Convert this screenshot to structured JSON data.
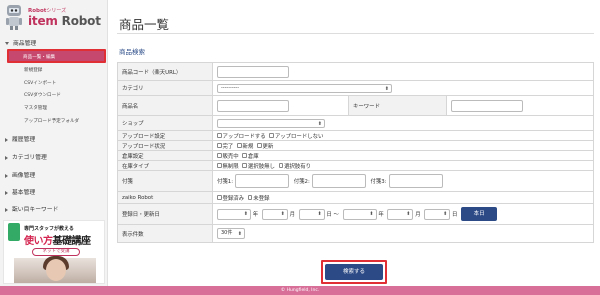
{
  "brand": {
    "small": "Robot",
    "small_sub": "シリーズ",
    "big_a": "item ",
    "big_b": "Robot"
  },
  "sidebar": {
    "sections": [
      {
        "label": "商品管理",
        "expanded": true,
        "items": [
          "商品一覧・編集",
          "新規登録",
          "CSVインポート",
          "CSVダウンロード",
          "マスタ管理",
          "アップロード予定フォルダ"
        ]
      },
      {
        "label": "履歴管理",
        "expanded": false
      },
      {
        "label": "カテゴリ管理",
        "expanded": false
      },
      {
        "label": "画像管理",
        "expanded": false
      },
      {
        "label": "基本管理",
        "expanded": false
      },
      {
        "label": "翫い目キーワード",
        "expanded": false
      }
    ],
    "active_item": "商品一覧・編集"
  },
  "banner": {
    "line1": "専門スタッフが教える",
    "line2a": "使い方",
    "line2b": "基礎講座",
    "button": "ネットで受講"
  },
  "page": {
    "title": "商品一覧",
    "section": "商品検索"
  },
  "form": {
    "product_code": "商品コード（楽天URL）",
    "category": "カテゴリ",
    "category_value": "----------",
    "product_name": "商品名",
    "keyword": "キーワード",
    "shop": "ショップ",
    "upload_setting": "アップロード設定",
    "upload_setting_opts": [
      "アップロードする",
      "アップロードしない"
    ],
    "upload_status": "アップロード状況",
    "upload_status_opts": [
      "完了",
      "新規",
      "更新"
    ],
    "warehouse": "倉庫設定",
    "warehouse_opts": [
      "販売中",
      "倉庫"
    ],
    "stock_type": "在庫タイプ",
    "stock_type_opts": [
      "無制限",
      "選択肢無し",
      "選択肢有り"
    ],
    "tag": "付箋",
    "tag_labels": [
      "付箋1:",
      "付箋2:",
      "付箋3:"
    ],
    "zaiko_robot": "zaiko Robot",
    "zaiko_opts": [
      "登録済み",
      "未登録"
    ],
    "date": "登録日・更新日",
    "date_units": [
      "年",
      "月",
      "日 〜",
      "年",
      "月",
      "日"
    ],
    "today_button": "本日",
    "display_count": "表示件数",
    "display_count_value": "30件"
  },
  "search_button": "検索する",
  "footer": "© Hungfield, Inc."
}
